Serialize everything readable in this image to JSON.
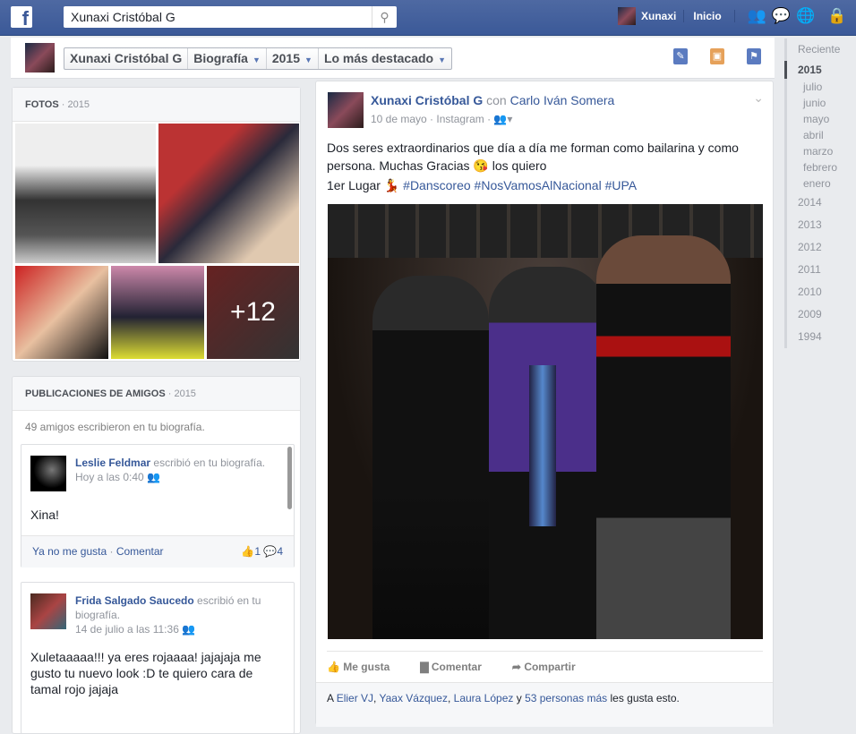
{
  "topbar": {
    "search_value": "Xunaxi Cristóbal G",
    "user": "Xunaxi",
    "home": "Inicio"
  },
  "subheader": {
    "crumbs": [
      "Xunaxi Cristóbal G",
      "Biografía",
      "2015",
      "Lo más destacado"
    ]
  },
  "timeline_nav": {
    "recent": "Reciente",
    "active_year": "2015",
    "months": [
      "julio",
      "junio",
      "mayo",
      "abril",
      "marzo",
      "febrero",
      "enero"
    ],
    "years": [
      "2014",
      "2013",
      "2012",
      "2011",
      "2010",
      "2009",
      "1994"
    ]
  },
  "photos": {
    "title": "FOTOS",
    "year": "2015",
    "more": "+12"
  },
  "friend_posts": {
    "title": "PUBLICACIONES DE AMIGOS",
    "year": "2015",
    "summary": "49 amigos escribieron en tu biografía.",
    "items": [
      {
        "name": "Leslie Feldmar",
        "action": "escribió en tu biografía.",
        "time": "Hoy a las 0:40",
        "text": "Xina!",
        "unlike": "Ya no me gusta",
        "comment": "Comentar",
        "likes": "1",
        "comments": "4"
      },
      {
        "name": "Frida Salgado Saucedo",
        "action": "escribió en tu biografía.",
        "time": "14 de julio a las 11:36",
        "text": "Xuletaaaaa!!! ya eres rojaaaa! jajajaja me gusto tu nuevo look :D te quiero cara de tamal rojo jajaja"
      }
    ]
  },
  "post": {
    "author": "Xunaxi Cristóbal G",
    "with_word": "con",
    "tagged": "Carlo Iván Somera",
    "date": "10 de mayo",
    "source": "Instagram",
    "text1": "Dos seres extraordinarios que día a día me forman como bailarina y como persona. Muchas Gracias",
    "text1_end": "los quiero",
    "text2": "1er Lugar",
    "hashtags": [
      "#Danscoreo",
      "#NosVamosAlNacional",
      "#UPA"
    ],
    "like": "Me gusta",
    "comment": "Comentar",
    "share": "Compartir",
    "likes_prefix": "A",
    "likers": [
      "Elier VJ",
      "Yaax Vázquez",
      "Laura López"
    ],
    "likes_and": "y",
    "likes_more": "53 personas más",
    "likes_suffix": "les gusta esto."
  }
}
